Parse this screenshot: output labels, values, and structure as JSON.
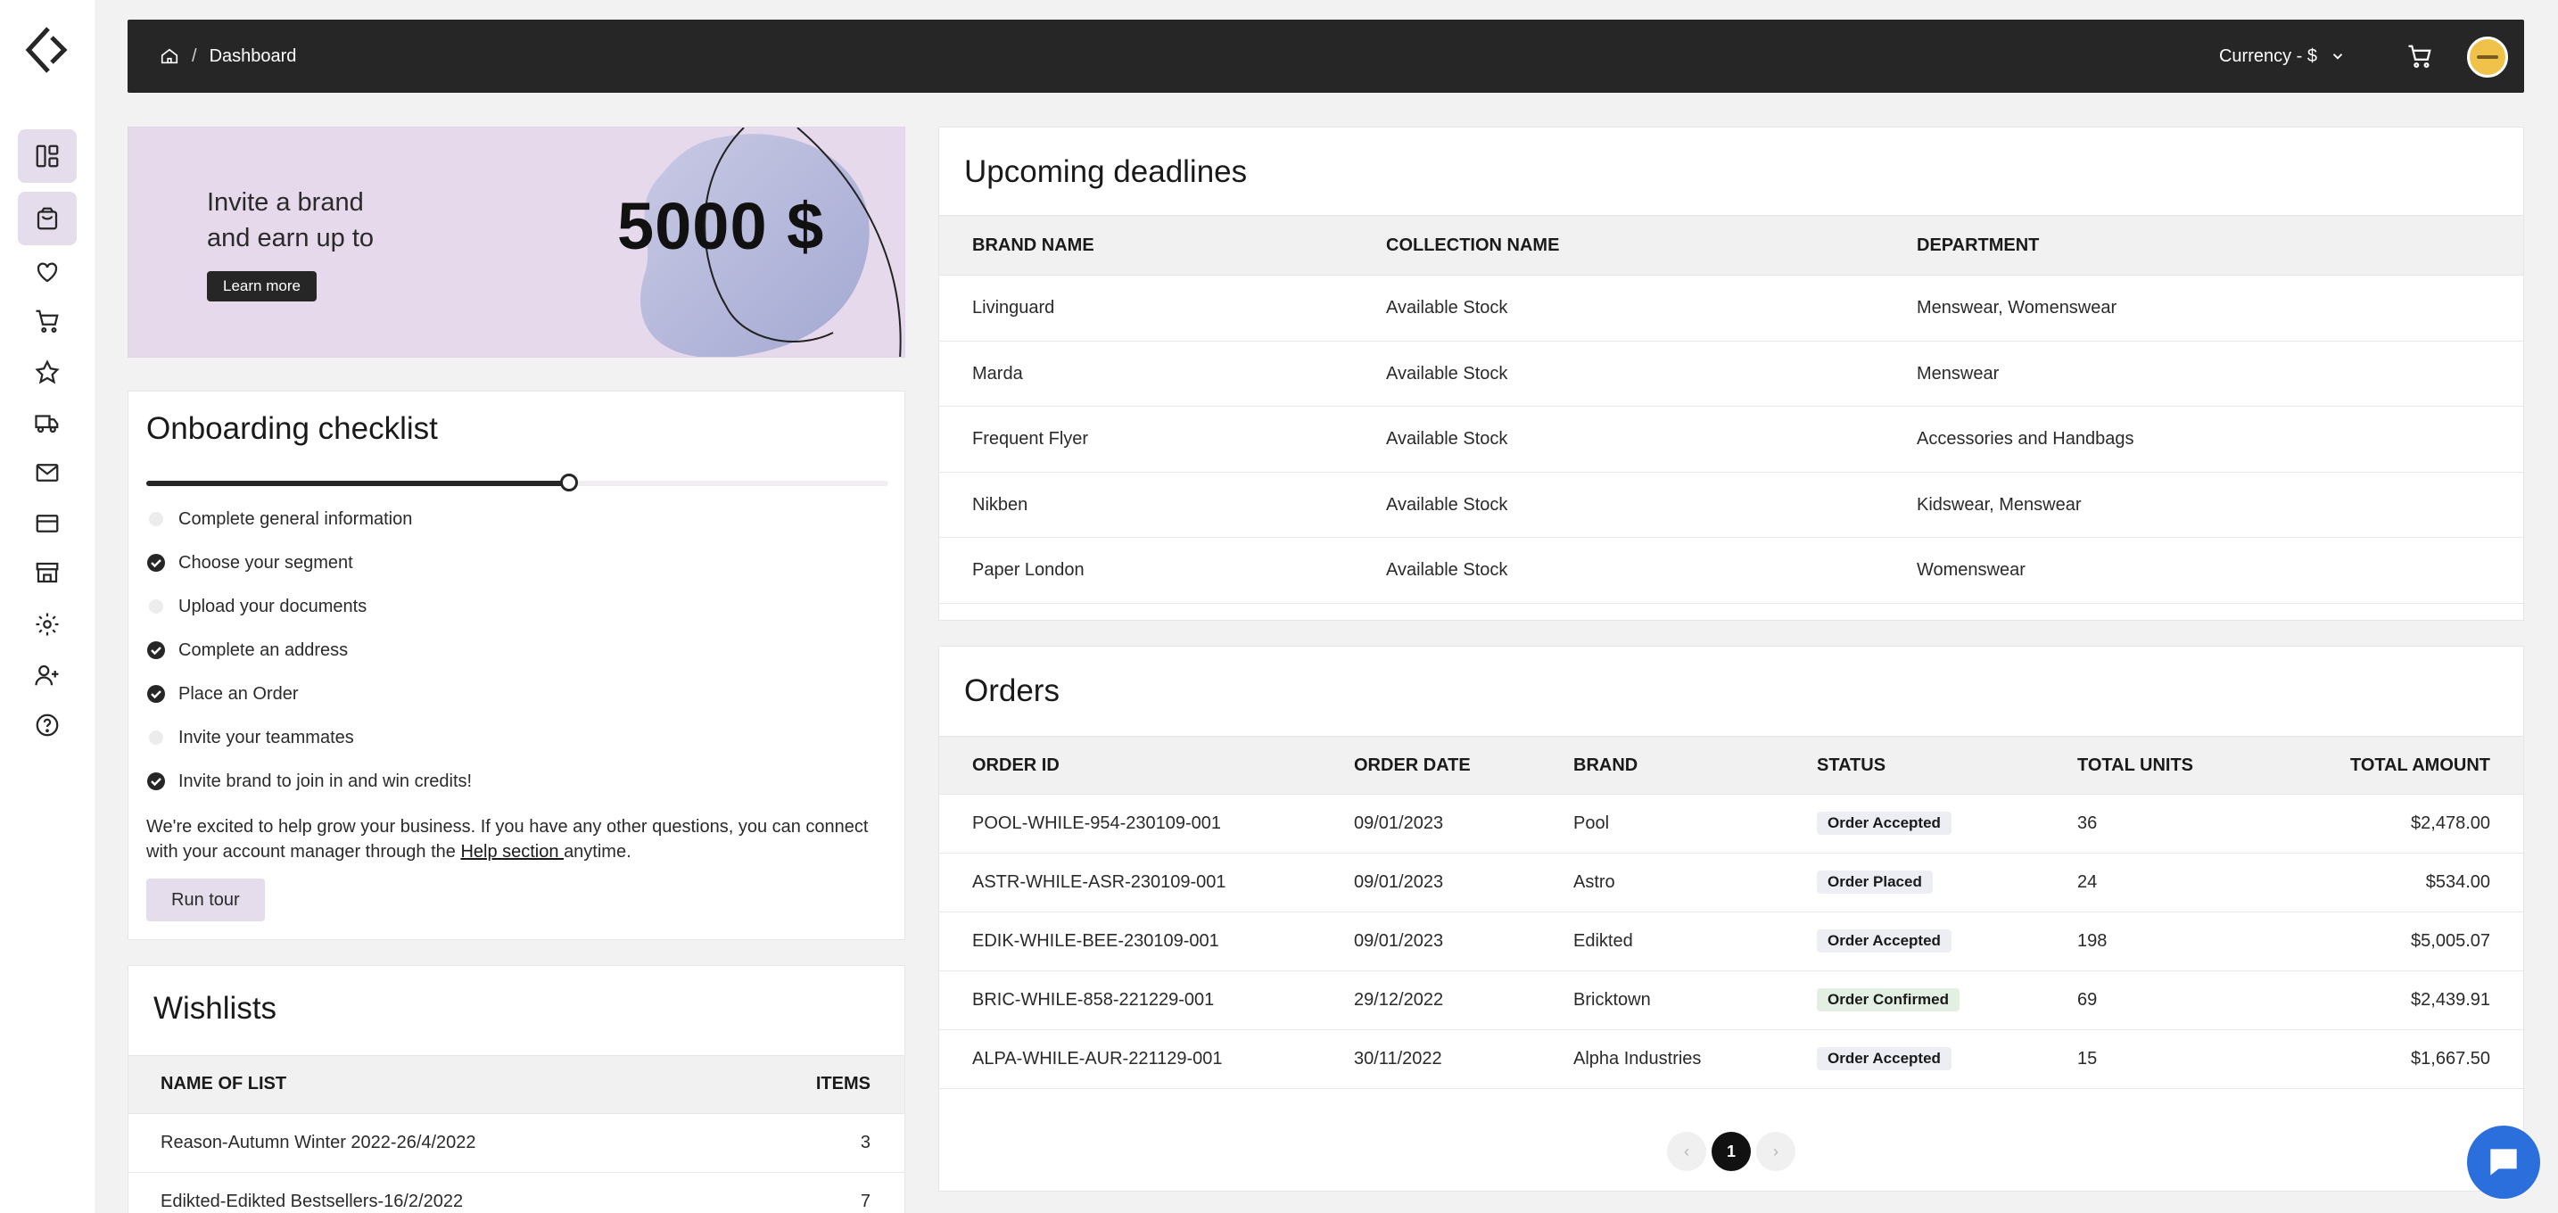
{
  "sidebar": {
    "items": [
      {
        "icon": "dashboard-icon",
        "active": true
      },
      {
        "icon": "shopping-bag-icon",
        "active": true
      },
      {
        "icon": "heart-icon",
        "active": false
      },
      {
        "icon": "cart-icon",
        "active": false
      },
      {
        "icon": "star-icon",
        "active": false
      },
      {
        "icon": "truck-icon",
        "active": false
      },
      {
        "icon": "mail-icon",
        "active": false
      },
      {
        "icon": "credit-card-icon",
        "active": false
      },
      {
        "icon": "store-icon",
        "active": false
      },
      {
        "icon": "gear-icon",
        "active": false
      },
      {
        "icon": "add-user-icon",
        "active": false
      },
      {
        "icon": "help-icon",
        "active": false
      }
    ]
  },
  "topbar": {
    "breadcrumb_sep": "/",
    "breadcrumb_page": "Dashboard",
    "currency_label": "Currency - $"
  },
  "banner": {
    "line1": "Invite a brand",
    "line2": "and earn up to",
    "button": "Learn more",
    "amount": "5000 $"
  },
  "onboarding": {
    "title": "Onboarding checklist",
    "progress": 0.57,
    "items": [
      {
        "label": "Complete general information",
        "done": false
      },
      {
        "label": "Choose your segment",
        "done": true
      },
      {
        "label": "Upload your documents",
        "done": false
      },
      {
        "label": "Complete an address",
        "done": true
      },
      {
        "label": "Place an Order",
        "done": true
      },
      {
        "label": "Invite your teammates",
        "done": false
      },
      {
        "label": "Invite brand to join in and win credits!",
        "done": true
      }
    ],
    "intro_before": "We're excited to help grow your business. If you have any other questions, you can connect with your account manager through the ",
    "intro_link": "Help section ",
    "intro_after": "anytime.",
    "button": "Run tour"
  },
  "wishlists": {
    "title": "Wishlists",
    "columns": [
      "NAME OF LIST",
      "ITEMS"
    ],
    "rows": [
      {
        "name": "Reason-Autumn Winter 2022-26/4/2022",
        "items": "3"
      },
      {
        "name": "Edikted-Edikted Bestsellers-16/2/2022",
        "items": "7"
      }
    ]
  },
  "deadlines": {
    "title": "Upcoming deadlines",
    "columns": [
      "BRAND NAME",
      "COLLECTION NAME",
      "DEPARTMENT"
    ],
    "rows": [
      {
        "brand": "Livinguard",
        "collection": "Available Stock",
        "department": "Menswear, Womenswear"
      },
      {
        "brand": "Marda",
        "collection": "Available Stock",
        "department": "Menswear"
      },
      {
        "brand": "Frequent Flyer",
        "collection": "Available Stock",
        "department": "Accessories and Handbags"
      },
      {
        "brand": "Nikben",
        "collection": "Available Stock",
        "department": "Kidswear, Menswear"
      },
      {
        "brand": "Paper London",
        "collection": "Available Stock",
        "department": "Womenswear"
      }
    ]
  },
  "orders": {
    "title": "Orders",
    "columns": [
      "ORDER ID",
      "ORDER DATE",
      "BRAND",
      "STATUS",
      "TOTAL UNITS",
      "TOTAL AMOUNT"
    ],
    "rows": [
      {
        "id": "POOL-WHILE-954-230109-001",
        "date": "09/01/2023",
        "brand": "Pool",
        "status": "Order Accepted",
        "units": "36",
        "amount": "$2,478.00"
      },
      {
        "id": "ASTR-WHILE-ASR-230109-001",
        "date": "09/01/2023",
        "brand": "Astro",
        "status": "Order Placed",
        "units": "24",
        "amount": "$534.00"
      },
      {
        "id": "EDIK-WHILE-BEE-230109-001",
        "date": "09/01/2023",
        "brand": "Edikted",
        "status": "Order Accepted",
        "units": "198",
        "amount": "$5,005.07"
      },
      {
        "id": "BRIC-WHILE-858-221229-001",
        "date": "29/12/2022",
        "brand": "Bricktown",
        "status": "Order Confirmed",
        "units": "69",
        "amount": "$2,439.91"
      },
      {
        "id": "ALPA-WHILE-AUR-221129-001",
        "date": "30/11/2022",
        "brand": "Alpha Industries",
        "status": "Order Accepted",
        "units": "15",
        "amount": "$1,667.50"
      }
    ],
    "pagination": {
      "prev": "‹",
      "current": "1",
      "next": "›"
    }
  }
}
